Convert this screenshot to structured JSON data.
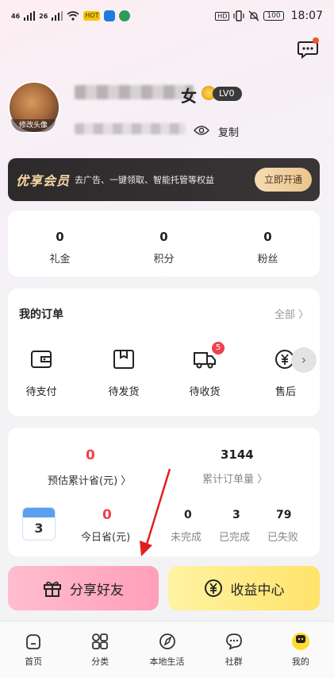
{
  "status_bar": {
    "signal_left": "46",
    "signal_right": "26",
    "app_chip": "HOT",
    "hd": "HD",
    "battery": "100",
    "time": "18:07"
  },
  "profile": {
    "name_suffix": "女",
    "avatar_caption": "修改头像",
    "level": "LV0",
    "copy_label": "复制"
  },
  "vip": {
    "logo": "优享会员",
    "desc": "去广告、一键领取、智能托管等权益",
    "button": "立即开通"
  },
  "stats": [
    {
      "value": "0",
      "label": "礼金"
    },
    {
      "value": "0",
      "label": "积分"
    },
    {
      "value": "0",
      "label": "粉丝"
    }
  ],
  "orders": {
    "title": "我的订单",
    "all": "全部 〉",
    "items": [
      {
        "label": "待支付",
        "icon": "wallet-icon"
      },
      {
        "label": "待发货",
        "icon": "box-icon"
      },
      {
        "label": "待收货",
        "icon": "truck-icon",
        "badge": "5"
      },
      {
        "label": "售后",
        "icon": "yen-circle-icon"
      }
    ]
  },
  "savings": {
    "estimated_value": "0",
    "estimated_label": "预估累计省(元) 〉",
    "orders_value": "3144",
    "orders_label": "累计订单量 〉",
    "calendar_day": "3",
    "today_value": "0",
    "today_label": "今日省(元)",
    "unfinished_value": "0",
    "unfinished_label": "未完成",
    "finished_value": "3",
    "finished_label": "已完成",
    "failed_value": "79",
    "failed_label": "已失败"
  },
  "actions": {
    "share": "分享好友",
    "earnings": "收益中心"
  },
  "tabs": [
    {
      "label": "首页",
      "icon": "home-icon"
    },
    {
      "label": "分类",
      "icon": "grid-icon"
    },
    {
      "label": "本地生活",
      "icon": "compass-icon"
    },
    {
      "label": "社群",
      "icon": "chat-icon"
    },
    {
      "label": "我的",
      "icon": "me-icon"
    }
  ],
  "colors": {
    "accent_red": "#f0414a",
    "vip_gold": "#f5d7a4",
    "share_pink": "#ff9fb9",
    "earn_yellow": "#ffe36a",
    "arrow_red": "#e02020"
  }
}
